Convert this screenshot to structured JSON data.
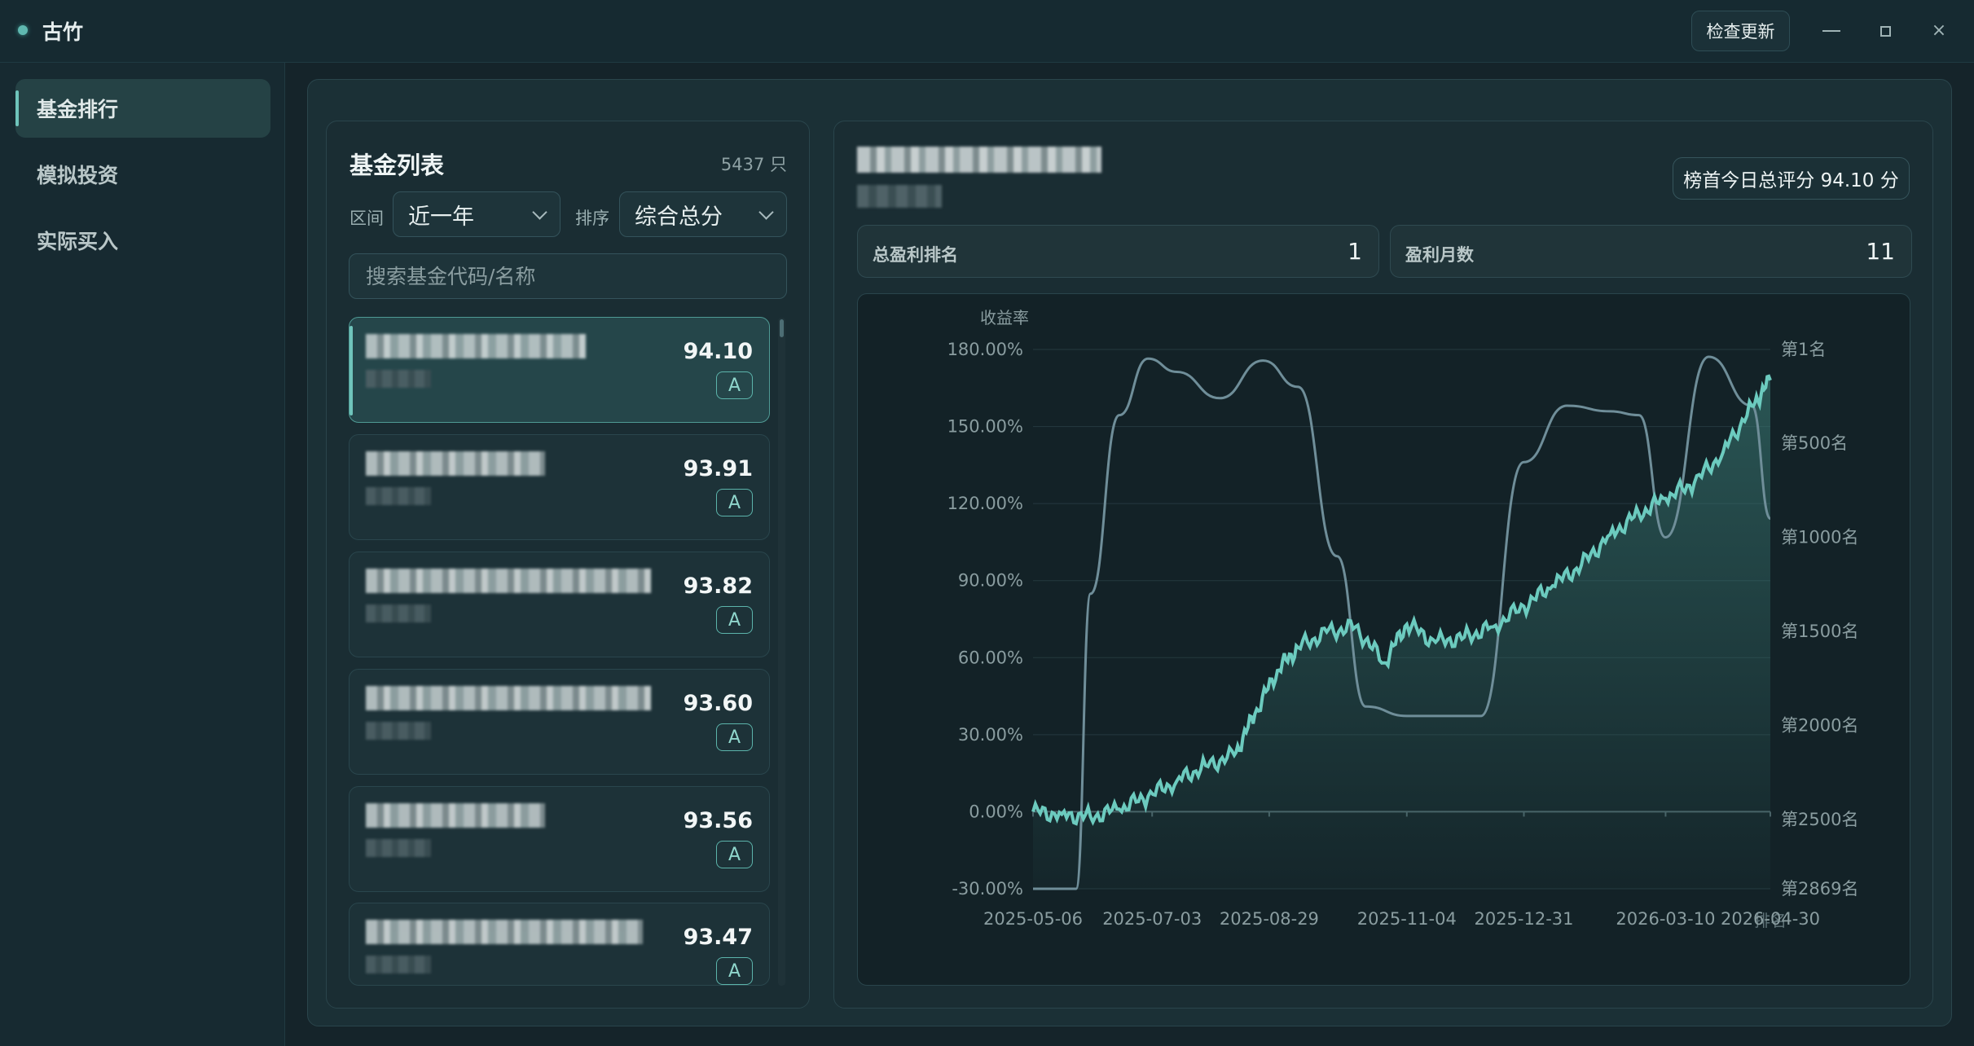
{
  "titlebar": {
    "title": "古竹",
    "update_button": "检查更新",
    "min_icon": "minimize-icon",
    "max_icon": "maximize-icon",
    "close_icon": "close-icon",
    "close_glyph": "×"
  },
  "sidebar": {
    "items": [
      {
        "label": "基金排行",
        "active": true
      },
      {
        "label": "模拟投资"
      },
      {
        "label": "实际买入"
      }
    ]
  },
  "fund_list": {
    "title": "基金列表",
    "count": "5437 只",
    "period_label": "区间",
    "period_value": "近一年",
    "sort_label": "排序",
    "sort_value": "综合总分",
    "search_placeholder": "搜索基金代码/名称",
    "cards": [
      {
        "score": "94.10",
        "grade": "A"
      },
      {
        "score": "93.91",
        "grade": "A"
      },
      {
        "score": "93.82",
        "grade": "A"
      },
      {
        "score": "93.60",
        "grade": "A"
      },
      {
        "score": "93.56",
        "grade": "A"
      },
      {
        "score": "93.47",
        "grade": "A"
      }
    ]
  },
  "detail": {
    "top_badge": "榜首今日总评分 94.10 分",
    "stats": [
      {
        "label": "总盈利排名",
        "value": "1"
      },
      {
        "label": "盈利月数",
        "value": "11"
      }
    ]
  },
  "chart_data": {
    "type": "line",
    "ylabel": "收益率",
    "y2label": "排名",
    "x_ticks": [
      "2025-05-06",
      "2025-07-03",
      "2025-08-29",
      "2025-11-04",
      "2025-12-31",
      "2026-03-10",
      "2026-04-30"
    ],
    "y_ticks": [
      "180.00%",
      "150.00%",
      "120.00%",
      "90.00%",
      "60.00%",
      "30.00%",
      "0.00%",
      "-30.00%"
    ],
    "ylim": [
      -30,
      180
    ],
    "y2_ticks": [
      "第1名",
      "第500名",
      "第1000名",
      "第1500名",
      "第2000名",
      "第2500名",
      "第2869名"
    ],
    "y2lim": [
      1,
      2869
    ],
    "colors": {
      "return_line": "#6ccbbf",
      "rank_line": "#6f8e99",
      "grid": "#24393f"
    },
    "series": [
      {
        "kind": "return",
        "x": [
          "2025-05-06",
          "2025-05-20",
          "2025-06-03",
          "2025-06-17",
          "2025-07-01",
          "2025-07-15",
          "2025-07-29",
          "2025-08-12",
          "2025-08-22",
          "2025-09-02",
          "2025-09-12",
          "2025-09-26",
          "2025-10-10",
          "2025-10-24",
          "2025-11-04",
          "2025-11-18",
          "2025-12-02",
          "2025-12-16",
          "2025-12-31",
          "2026-01-14",
          "2026-01-28",
          "2026-02-11",
          "2026-02-25",
          "2026-03-10",
          "2026-03-24",
          "2026-04-07",
          "2026-04-21",
          "2026-04-30"
        ],
        "values": [
          0,
          -1,
          -2,
          1,
          6,
          12,
          18,
          22,
          38,
          55,
          64,
          70,
          72,
          58,
          73,
          66,
          68,
          72,
          80,
          88,
          96,
          108,
          116,
          122,
          128,
          140,
          158,
          168
        ]
      },
      {
        "kind": "rank",
        "x": [
          "2025-05-06",
          "2025-05-27",
          "2025-06-03",
          "2025-06-17",
          "2025-07-01",
          "2025-07-15",
          "2025-08-05",
          "2025-08-26",
          "2025-09-12",
          "2025-10-01",
          "2025-10-15",
          "2025-11-04",
          "2025-11-25",
          "2025-12-10",
          "2025-12-31",
          "2026-01-21",
          "2026-02-11",
          "2026-02-25",
          "2026-03-10",
          "2026-03-31",
          "2026-04-21",
          "2026-04-30"
        ],
        "values": [
          2869,
          2869,
          1300,
          350,
          50,
          120,
          260,
          60,
          200,
          1100,
          1900,
          1950,
          1950,
          1950,
          600,
          300,
          330,
          350,
          1000,
          40,
          300,
          900
        ]
      }
    ]
  }
}
